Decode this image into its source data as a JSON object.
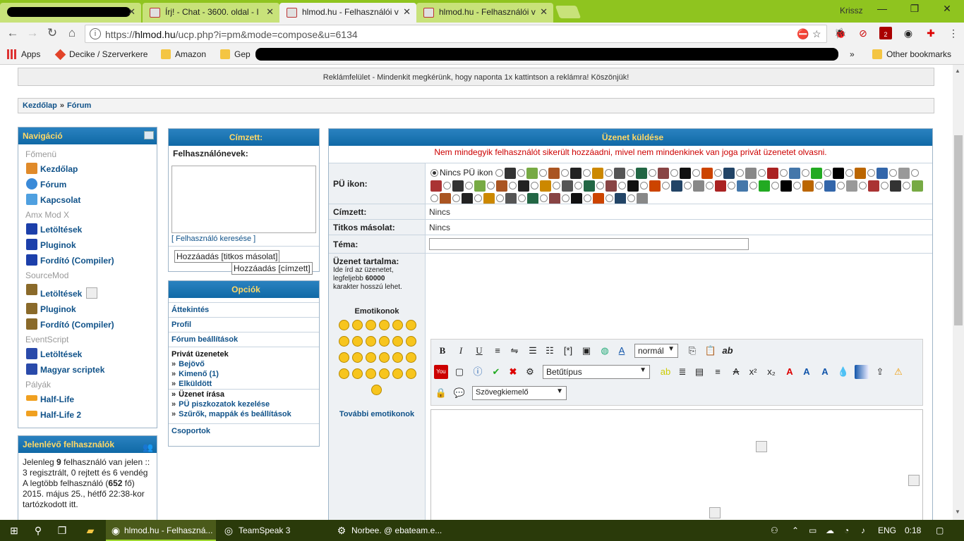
{
  "browser": {
    "tabs": [
      {
        "title": "Írj! - Chat - 3600. oldal - I",
        "active": false
      },
      {
        "title": "hlmod.hu - Felhasználói v",
        "active": true
      },
      {
        "title": "hlmod.hu - Felhasználói v",
        "active": false
      }
    ],
    "user": "Krissz",
    "url_host": "hlmod.hu",
    "url_prefix": "https://",
    "url_path": "/ucp.php?i=pm&mode=compose&u=6134",
    "bookmarks": {
      "apps": "Apps",
      "decike": "Decike / Szerverkere",
      "amazon": "Amazon",
      "gep": "Gep",
      "more": "»",
      "other": "Other bookmarks"
    },
    "ext_badge": "2"
  },
  "page": {
    "ad_text": "Reklámfelület - Mindenkit megkérünk, hogy naponta 1x kattintson a reklámra! Köszönjük!",
    "breadcrumb": {
      "home": "Kezdőlap",
      "sep": "»",
      "forum": "Fórum"
    }
  },
  "nav": {
    "title": "Navigáció",
    "main_section": "Főmenü",
    "home": "Kezdőlap",
    "forum": "Fórum",
    "contact": "Kapcsolat",
    "amx_section": "Amx Mod X",
    "amx_downloads": "Letöltések",
    "amx_plugins": "Pluginok",
    "amx_compiler": "Fordító (Compiler)",
    "sm_section": "SourceMod",
    "sm_downloads": "Letöltések",
    "sm_plugins": "Pluginok",
    "sm_compiler": "Fordító (Compiler)",
    "es_section": "EventScript",
    "es_downloads": "Letöltések",
    "es_scripts": "Magyar scriptek",
    "maps_section": "Pályák",
    "hl1": "Half-Life",
    "hl2": "Half-Life 2"
  },
  "online": {
    "title": "Jelenlévő felhasználók",
    "line1_pre": "Jelenleg ",
    "line1_count": "9",
    "line1_post": " felhasználó van jelen :: 3 regisztrált, 0 rejtett és 6 vendég",
    "line2_pre": "A legtöbb felhasználó (",
    "line2_count": "652",
    "line2_post": " fő) 2015. május 25., hétfő 22:38-kor tartózkodott itt."
  },
  "recipient": {
    "title": "Címzett:",
    "usernames_label": "Felhasználónevek:",
    "search_link": "[ Felhasználó keresése ]",
    "add_bcc": "Hozzáadás [titkos másolat]",
    "add_to": "Hozzáadás [címzett]"
  },
  "options": {
    "title": "Opciók",
    "overview": "Áttekintés",
    "profile": "Profil",
    "forum_settings": "Fórum beállítások",
    "pm_heading": "Privát üzenetek",
    "inbox": "Bejövő",
    "outbox": "Kimenő (1)",
    "sent": "Elküldött",
    "compose": "Üzenet írása",
    "drafts": "PÜ piszkozatok kezelése",
    "filters": "Szűrők, mappák és beállítások",
    "groups": "Csoportok",
    "arrow": "»"
  },
  "compose": {
    "title": "Üzenet küldése",
    "error": "Nem mindegyik felhasználót sikerült hozzáadni, mivel nem mindenkinek van joga privát üzenetet olvasni.",
    "icon_label": "PÜ ikon:",
    "no_icon": "Nincs PÜ ikon",
    "to_label": "Címzett:",
    "to_value": "Nincs",
    "bcc_label": "Titkos másolat:",
    "bcc_value": "Nincs",
    "subject_label": "Téma:",
    "body_label": "Üzenet tartalma:",
    "body_hint_1": "Ide írd az üzenetet,",
    "body_hint_2_pre": "legfeljebb ",
    "body_hint_2_num": "60000",
    "body_hint_3": "karakter hosszú lehet.",
    "emoticons_title": "Emotikonok",
    "more_emoticons": "További emotikonok",
    "font_size": "normál",
    "font_face": "Betűtípus",
    "highlighter": "Szövegkiemelő"
  },
  "colors": {
    "accent": "#105289",
    "header_gold": "#ffd866",
    "error": "#cc0000",
    "browser_green": "#8fc41f"
  },
  "taskbar": {
    "chrome": "hlmod.hu - Felhaszná...",
    "teamspeak": "TeamSpeak 3",
    "steam": "Norbee. @ ebateam.e...",
    "lang": "ENG",
    "time": "0:18"
  }
}
